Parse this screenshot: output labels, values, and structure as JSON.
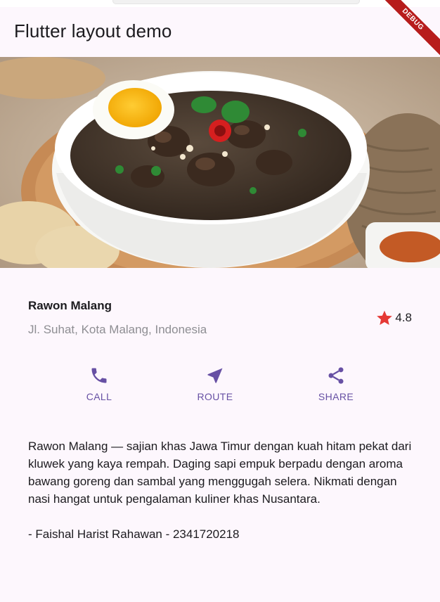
{
  "app": {
    "title": "Flutter layout demo",
    "debug_banner": "DEBUG"
  },
  "dish": {
    "name": "Rawon Malang",
    "location": "Jl. Suhat, Kota Malang, Indonesia",
    "rating": "4.8",
    "image_alt": "Rawon soup with beef, egg, and chili"
  },
  "actions": [
    {
      "label": "CALL",
      "icon": "phone-icon"
    },
    {
      "label": "ROUTE",
      "icon": "navigation-icon"
    },
    {
      "label": "SHARE",
      "icon": "share-icon"
    }
  ],
  "description": {
    "text": "Rawon Malang — sajian khas Jawa Timur dengan kuah hitam pekat dari kluwek yang kaya rempah. Daging sapi empuk berpadu dengan aroma bawang goreng dan sambal yang menggugah selera. Nikmati dengan nasi hangat untuk pengalaman kuliner khas Nusantara.",
    "author": "- Faishal Harist Rahawan - 2341720218"
  },
  "colors": {
    "accent": "#6750a4",
    "star": "#e53935",
    "background": "#fdf7fd"
  }
}
